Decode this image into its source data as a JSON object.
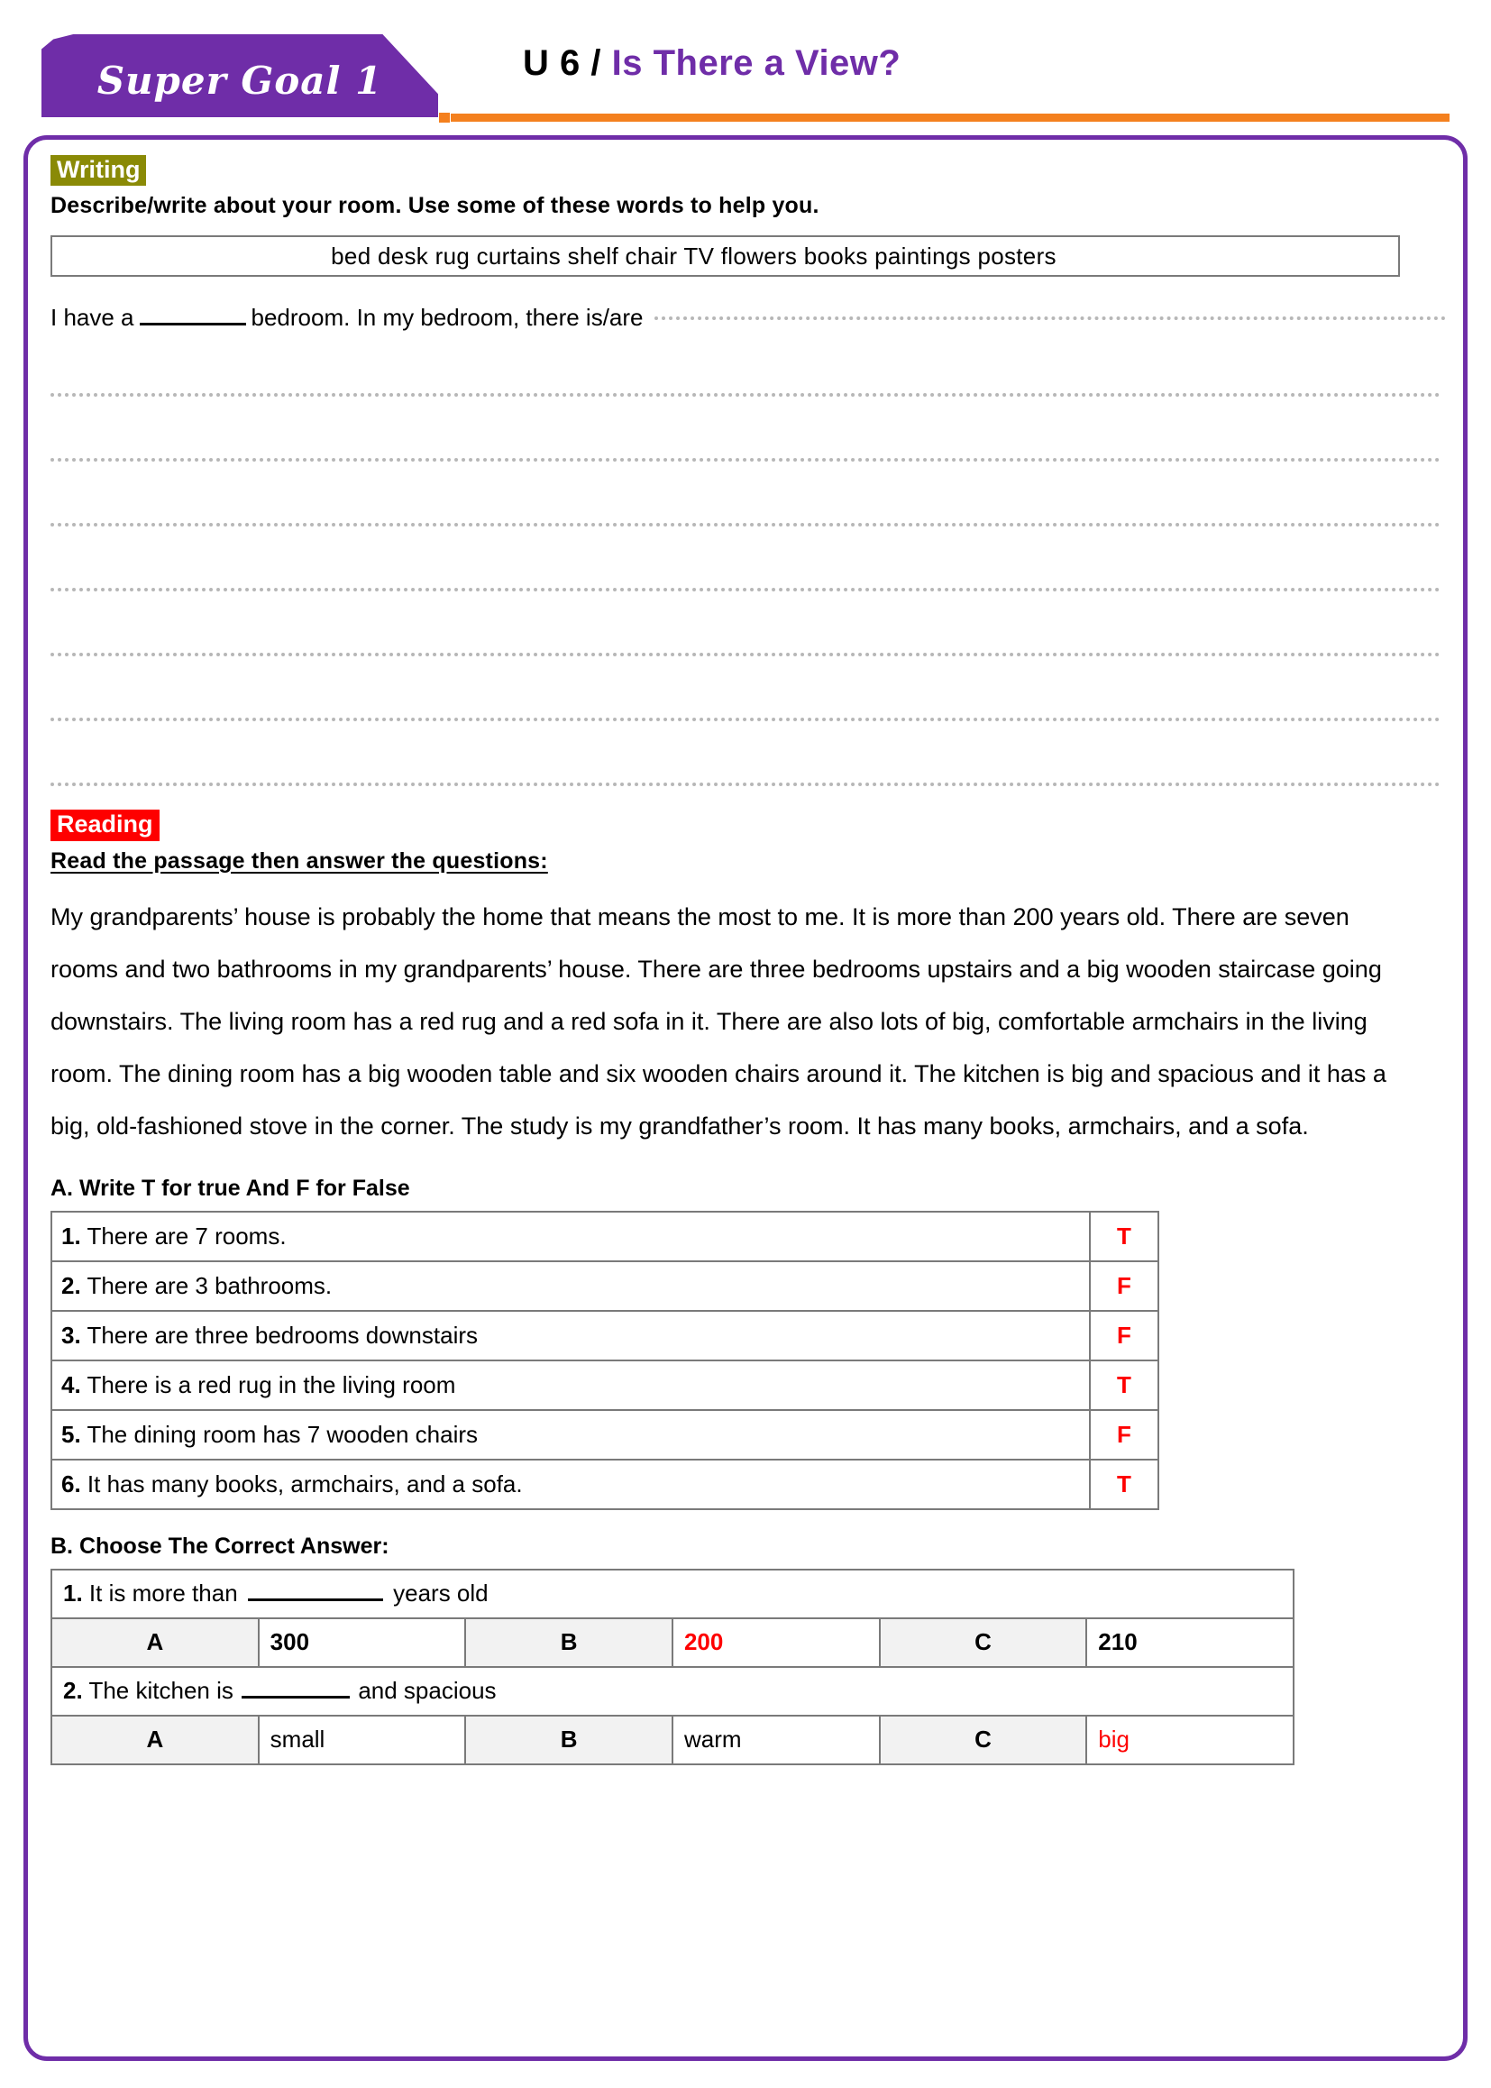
{
  "header": {
    "book_tab": "Super Goal 1",
    "unit_label": "U 6 /",
    "unit_topic": "Is There a View?",
    "accent_purple": "#6f2da8",
    "accent_orange": "#f4801e"
  },
  "writing": {
    "tag": "Writing",
    "instruction": "Describe/write about your room. Use some of these words to help you.",
    "wordbank": "bed   desk   rug   curtains   shelf   chair   TV   flowers   books   paintings   posters",
    "wordbank_items": [
      "bed",
      "desk",
      "rug",
      "curtains",
      "shelf",
      "chair",
      "TV",
      "flowers",
      "books",
      "paintings",
      "posters"
    ],
    "prompt_start": "I have a",
    "prompt_middle": "bedroom. In my bedroom, there is/are",
    "blank_lines_count": 7
  },
  "reading": {
    "tag": "Reading",
    "instruction": "Read the passage then answer the questions:",
    "passage": " My grandparents’ house is probably the home that means the most to me. It is more than 200 years old. There are seven rooms and two bathrooms in my grandparents’ house. There are three bedrooms upstairs and a big wooden staircase going downstairs. The living room has a red rug and a red sofa in it. There are also lots of big, comfortable armchairs in the living room. The dining room has a big wooden table and six wooden chairs around it. The kitchen is big and spacious and it has a big, old-fashioned stove in the corner. The study is my grandfather’s room. It has many books, armchairs, and a sofa."
  },
  "part_a": {
    "title": "A. Write T for true And F for False",
    "answer_color": "#fe0000",
    "rows": [
      {
        "num": "1.",
        "statement": "There are 7 rooms.",
        "answer": "T"
      },
      {
        "num": "2.",
        "statement": "There are 3 bathrooms.",
        "answer": "F"
      },
      {
        "num": "3.",
        "statement": "There are three bedrooms downstairs",
        "answer": "F"
      },
      {
        "num": "4.",
        "statement": "There is a red rug in the living room",
        "answer": "T"
      },
      {
        "num": "5.",
        "statement": "The dining room has 7 wooden chairs",
        "answer": "F"
      },
      {
        "num": "6.",
        "statement": "It has many books, armchairs, and a sofa.",
        "answer": "T"
      }
    ]
  },
  "part_b": {
    "title": "B. Choose The Correct Answer:",
    "questions": [
      {
        "num": "1.",
        "text_before": "It is more than",
        "text_after": "years old",
        "letters": [
          "A",
          "B",
          "C"
        ],
        "options": [
          "300",
          "200",
          "210"
        ],
        "correct_index": 1,
        "bold_options": true
      },
      {
        "num": "2.",
        "text_before": "The kitchen is",
        "text_after": "and spacious",
        "letters": [
          "A",
          "B",
          "C"
        ],
        "options": [
          "small",
          "warm",
          "big"
        ],
        "correct_index": 2,
        "bold_options": false
      }
    ]
  }
}
